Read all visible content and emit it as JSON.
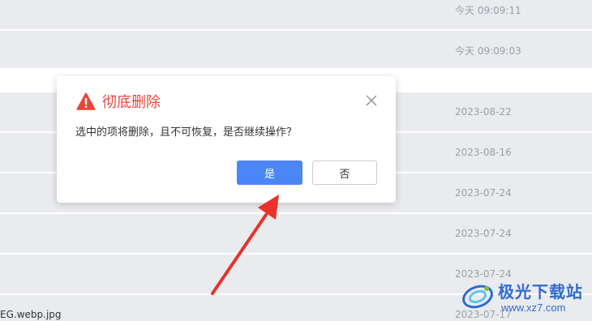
{
  "list": {
    "rows": [
      {
        "date": "今天 09:09:11"
      },
      {
        "date": "今天 09:09:03"
      },
      {
        "date": ""
      },
      {
        "date": "2023-08-22"
      },
      {
        "date": "2023-08-16"
      },
      {
        "date": "2023-07-24"
      },
      {
        "date": "2023-07-24"
      },
      {
        "date": "2023-07-24"
      },
      {
        "date": "2023-07-17"
      }
    ],
    "partial_file_name": "EG.webp.jpg"
  },
  "dialog": {
    "title": "彻底删除",
    "message": "选中的项将删除，且不可恢复，是否继续操作？",
    "confirm_label": "是",
    "cancel_label": "否",
    "icons": {
      "warning": "warning-triangle-icon",
      "close": "close-icon"
    },
    "colors": {
      "title": "#e8453c",
      "confirm": "#4a86f5",
      "annotation_arrow": "#e8322b"
    }
  },
  "watermark": {
    "name": "极光下载站",
    "url": "www.xz7.com"
  }
}
